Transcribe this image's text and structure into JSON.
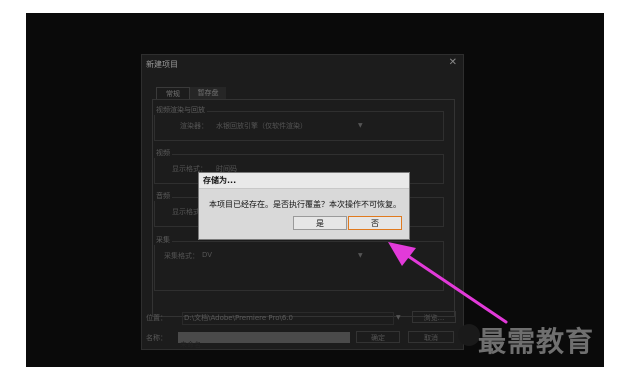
{
  "new_project": {
    "title": "新建项目",
    "tabs": [
      "常规",
      "暂存盘"
    ],
    "renderer_group": {
      "label": "视频渲染与回放",
      "row_label": "渲染器：",
      "row_value": "水银回放引擎（仅软件渲染）"
    },
    "video_group": {
      "label": "视频",
      "row_label": "显示格式：",
      "row_value": "时间码"
    },
    "audio_group": {
      "label": "音频",
      "row_label": "显示格式："
    },
    "capture_group": {
      "label": "采集",
      "row_label": "采集格式：",
      "row_value": "DV"
    },
    "location_label": "位置：",
    "location_value": "D:\\文档\\Adobe\\Premiere Pro\\6.0",
    "browse_label": "浏览...",
    "name_label": "名称：",
    "name_value": "未命名",
    "ok_label": "确定",
    "cancel_label": "取消"
  },
  "save_as": {
    "title": "存储为...",
    "message": "本项目已经存在。是否执行覆盖？本次操作不可恢复。",
    "yes_label": "是",
    "no_label": "否"
  },
  "watermark": "最需教育",
  "colors": {
    "annotation_arrow": "#e23ad9",
    "focus_border": "#e07a1f"
  }
}
